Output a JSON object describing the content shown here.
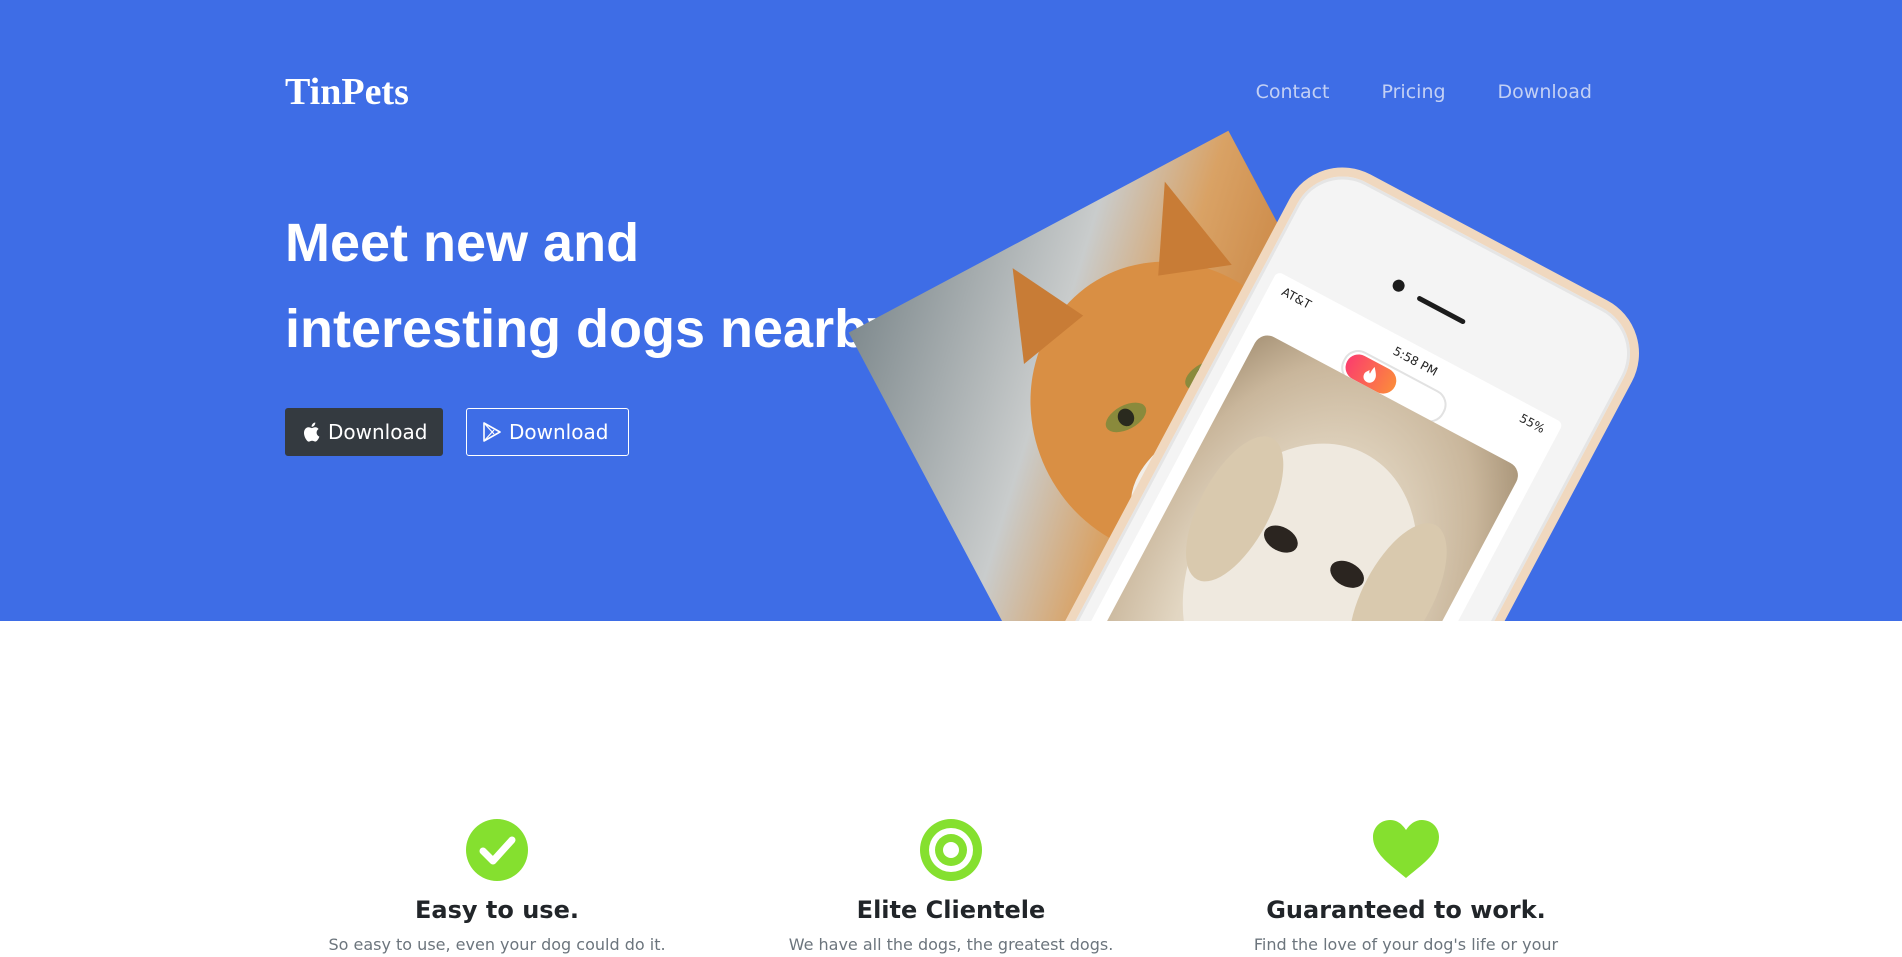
{
  "header": {
    "brand": "TinPets",
    "nav": [
      "Contact",
      "Pricing",
      "Download"
    ]
  },
  "hero": {
    "headline_line1": "Meet new and",
    "headline_line2": "interesting dogs nearby.",
    "buttons": [
      {
        "label": "Download",
        "icon": "apple-icon"
      },
      {
        "label": "Download",
        "icon": "google-play-icon"
      }
    ],
    "phone": {
      "carrier": "AT&T",
      "time": "5:58 PM",
      "battery": "55%"
    }
  },
  "features": [
    {
      "title": "Easy to use.",
      "text": "So easy to use, even your dog could do it.",
      "icon": "checkmark-circle-icon"
    },
    {
      "title": "Elite Clientele",
      "text": "We have all the dogs, the greatest dogs.",
      "icon": "target-icon"
    },
    {
      "title": "Guaranteed to work.",
      "text": "Find the love of your dog's life or your",
      "icon": "heart-icon"
    }
  ],
  "colors": {
    "hero_bg": "#3e6de6",
    "accent_green": "#85e02f",
    "dark_button": "#343a40"
  }
}
